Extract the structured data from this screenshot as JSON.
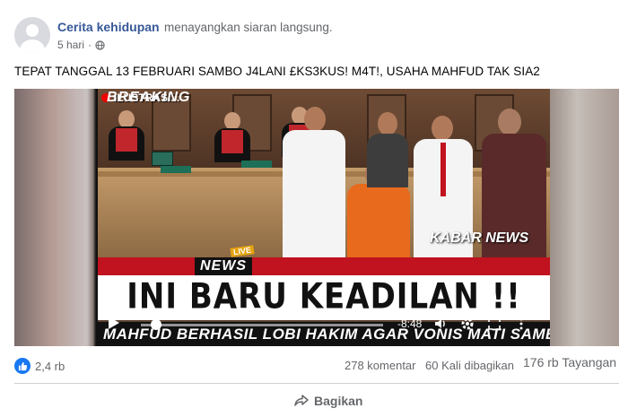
{
  "post": {
    "page_name": "Cerita kehidupan",
    "action": "menayangkan siaran langsung.",
    "time": "5 hari",
    "privacy_icon": "globe-icon",
    "text": "TEPAT TANGGAL 13 FEBRUARI SAMBO J4LANI £KS3KUS! M4T!, USAHA MAHFUD TAK SIA2"
  },
  "video": {
    "tag": "ILUSTRASI...",
    "channel": "KABAR NEWS",
    "breaking": "BREAKING",
    "news": "NEWS",
    "live": "LIVE",
    "headline": "INI BARU KEADILAN !!",
    "ticker": "MAHFUD BERHASIL LOBI HAKIM AGAR VONIS MATI SAMBO",
    "time": "-8:48",
    "progress": 0.04,
    "icons": [
      "play-icon",
      "volume-icon",
      "settings-icon",
      "fullscreen-icon",
      "more-icon"
    ]
  },
  "stats": {
    "reactions": "2,4 rb",
    "comments": "278 komentar",
    "shares": "60 Kali dibagikan",
    "views": "176 rb Tayangan"
  },
  "actions": {
    "share_label": "Bagikan"
  },
  "colors": {
    "link": "#385898",
    "meta": "#65676b",
    "like": "#1877f2",
    "breaking_red": "#c1121f"
  }
}
